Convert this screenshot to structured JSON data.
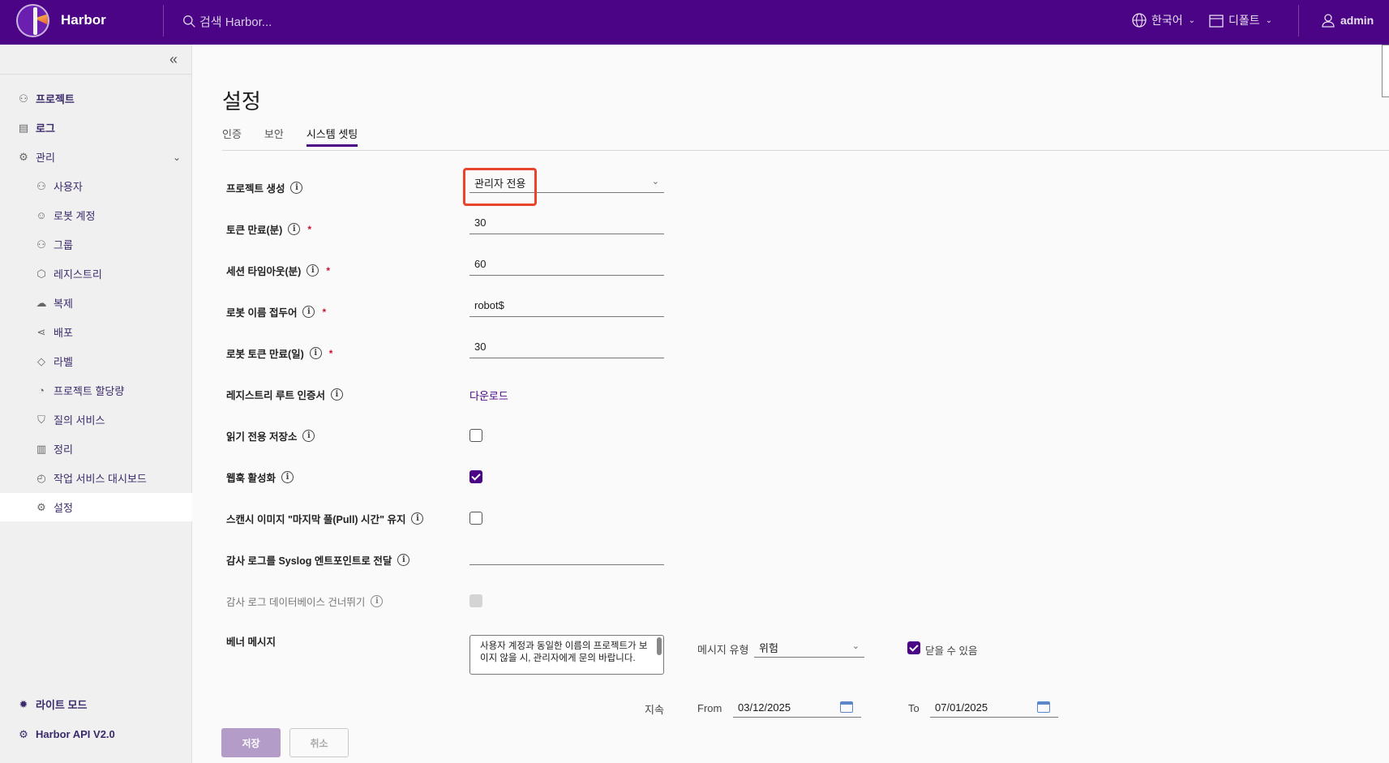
{
  "header": {
    "brand": "Harbor",
    "search_placeholder": "검색 Harbor...",
    "language": "한국어",
    "date_format": "디폴트",
    "user": "admin",
    "bg_color": "#4b0486"
  },
  "sidebar": {
    "items": [
      {
        "label": "프로젝트",
        "icon": "projects-icon"
      },
      {
        "label": "로그",
        "icon": "logs-icon"
      },
      {
        "label": "관리",
        "icon": "admin-icon"
      },
      {
        "label": "사용자",
        "icon": "users-icon"
      },
      {
        "label": "로봇 계정",
        "icon": "robot-icon"
      },
      {
        "label": "그룹",
        "icon": "groups-icon"
      },
      {
        "label": "레지스트리",
        "icon": "registry-icon"
      },
      {
        "label": "복제",
        "icon": "replication-icon"
      },
      {
        "label": "배포",
        "icon": "distribution-icon"
      },
      {
        "label": "라벨",
        "icon": "label-icon"
      },
      {
        "label": "프로젝트 할당량",
        "icon": "quota-icon"
      },
      {
        "label": "질의 서비스",
        "icon": "shield-icon"
      },
      {
        "label": "정리",
        "icon": "trash-icon"
      },
      {
        "label": "작업 서비스 대시보드",
        "icon": "dashboard-icon"
      },
      {
        "label": "설정",
        "icon": "gear-icon"
      }
    ],
    "light_mode": "라이트 모드",
    "api": "Harbor API V2.0"
  },
  "page": {
    "title": "설정",
    "tabs": [
      "인증",
      "보안",
      "시스템 셋팅"
    ],
    "active_tab": "시스템 셋팅"
  },
  "form": {
    "project_creation": {
      "label": "프로젝트 생성",
      "value": "관리자 전용"
    },
    "token_expiration": {
      "label": "토큰 만료(분)",
      "value": "30"
    },
    "session_timeout": {
      "label": "세션 타임아웃(분)",
      "value": "60"
    },
    "robot_prefix": {
      "label": "로봇 이름 접두어",
      "value": "robot$"
    },
    "robot_token_expiration": {
      "label": "로봇 토큰 만료(일)",
      "value": "30"
    },
    "root_cert": {
      "label": "레지스트리 루트 인증서",
      "link": "다운로드"
    },
    "read_only": {
      "label": "읽기 전용 저장소",
      "checked": false
    },
    "webhook": {
      "label": "웹훅 활성화",
      "checked": true
    },
    "skip_pull_time": {
      "label": "스캔시 이미지 \"마지막 풀(Pull) 시간\" 유지",
      "checked": false
    },
    "syslog": {
      "label": "감사 로그를 Syslog 엔트포인트로 전달",
      "value": ""
    },
    "skip_audit_db": {
      "label": "감사 로그 데이터베이스 건너뛰기",
      "checked": false,
      "disabled": true
    },
    "banner": {
      "label": "베너 메시지",
      "message": "사용자 계정과 동일한 이름의 프로젝트가 보이지 않을 시, 관리자에게 문의 바랍니다.",
      "type_label": "메시지 유형",
      "type_value": "위험",
      "closable_label": "닫을 수 있음",
      "closable": true,
      "duration_label": "지속",
      "from_label": "From",
      "from_value": "03/12/2025",
      "to_label": "To",
      "to_value": "07/01/2025"
    }
  },
  "buttons": {
    "save": "저장",
    "cancel": "취소"
  }
}
